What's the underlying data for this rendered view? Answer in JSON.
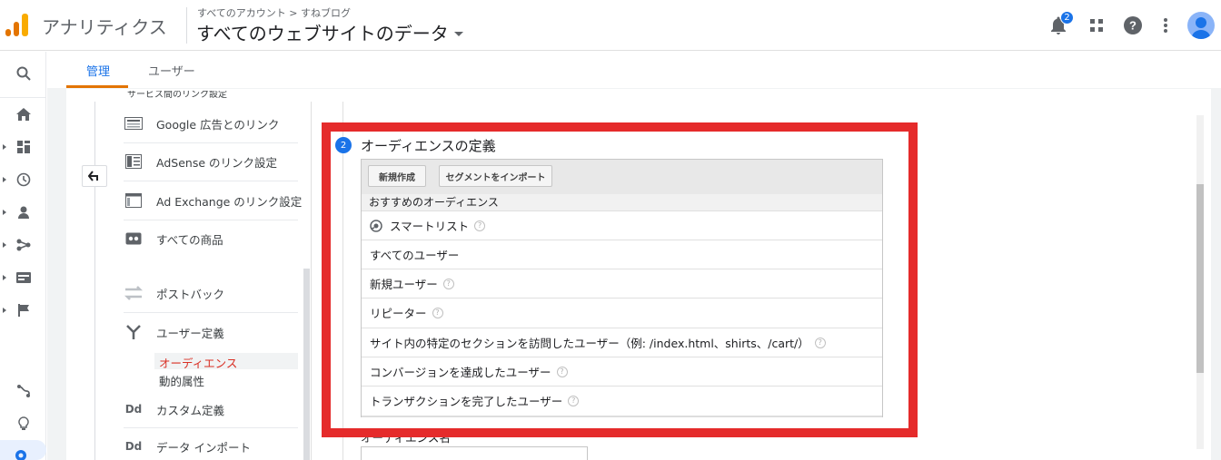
{
  "header": {
    "app_name": "アナリティクス",
    "breadcrumb": "すべてのアカウント > すねブログ",
    "property_title": "すべてのウェブサイトのデータ",
    "notification_count": "2"
  },
  "tabs": [
    {
      "label": "管理",
      "active": true
    },
    {
      "label": "ユーザー",
      "active": false
    }
  ],
  "admin_column": {
    "cut_off_text": "サービス間のリンク設定",
    "items": [
      {
        "label": "Google 広告とのリンク",
        "icon": "google-ads-icon"
      },
      {
        "label": "AdSense のリンク設定",
        "icon": "adsense-icon"
      },
      {
        "label": "Ad Exchange のリンク設定",
        "icon": "ad-exchange-icon"
      },
      {
        "label": "すべての商品",
        "icon": "all-products-icon"
      },
      {
        "label": "ポストバック",
        "icon": "postback-icon"
      },
      {
        "label": "ユーザー定義",
        "icon": "audience-definitions-icon"
      },
      {
        "label": "カスタム定義",
        "icon": "custom-definitions-icon"
      },
      {
        "label": "データ インポート",
        "icon": "data-import-icon"
      }
    ],
    "sub_items": [
      {
        "label": "オーディエンス",
        "active": true
      },
      {
        "label": "動的属性",
        "active": false
      }
    ],
    "dd_label": "Dd"
  },
  "audience_section": {
    "step_number": "2",
    "title": "オーディエンスの定義",
    "buttons": {
      "new": "新規作成",
      "import_segment": "セグメントをインポート"
    },
    "recommended_header": "おすすめのオーディエンス",
    "rows": [
      {
        "label": "スマートリスト",
        "help": true,
        "icon": "smart-list-icon"
      },
      {
        "label": "すべてのユーザー",
        "help": false
      },
      {
        "label": "新規ユーザー",
        "help": true
      },
      {
        "label": "リピーター",
        "help": true
      },
      {
        "label": "サイト内の特定のセクションを訪問したユーザー（例: /index.html、shirts、/cart/）",
        "help": true
      },
      {
        "label": "コンバージョンを達成したユーザー",
        "help": true
      },
      {
        "label": "トランザクションを完了したユーザー",
        "help": true
      }
    ],
    "below_label": "オーディエンス名"
  },
  "colors": {
    "accent": "#1a73e8",
    "tab_underline": "#e37400",
    "highlight_frame": "#e52b2b",
    "active_sub_item": "#d93025"
  }
}
